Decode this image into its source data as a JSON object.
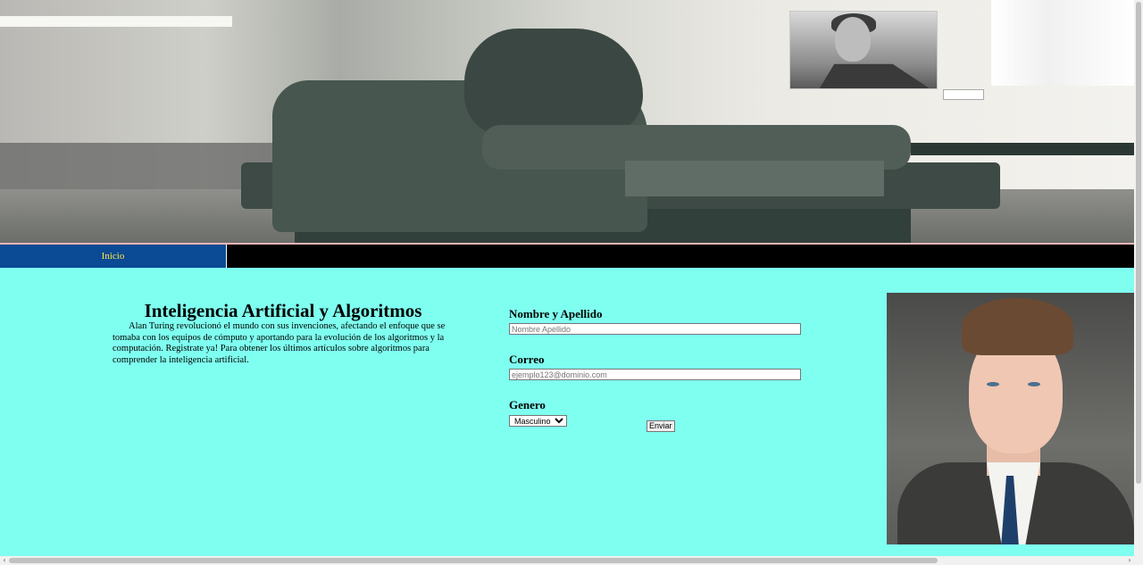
{
  "header": {
    "hero_image_alt": "",
    "nav": {
      "items": [
        {
          "label": "Inicio"
        }
      ]
    }
  },
  "intro": {
    "title": "Inteligencia Artificial y Algoritmos",
    "paragraph": "Alan Turing revolucionó el mundo con sus invenciones, afectando el enfoque que se tomaba con los equipos de cómputo y aportando para la evolución de los algoritmos y la computación. Registrate ya! Para obtener los últimos artículos sobre algoritmos para comprender la inteligencia artificial."
  },
  "form": {
    "name_label": "Nombre y Apellido",
    "name_placeholder": "Nombre Apellido",
    "email_label": "Correo",
    "email_placeholder": "ejemplo123@dominio.com",
    "gender_label": "Genero",
    "gender_selected": "Masculino",
    "submit_label": "Enviar"
  },
  "colors": {
    "page_bg": "#7ffff0",
    "nav_bg": "#000000",
    "nav_active_bg": "#0b4a94",
    "nav_active_text": "#ffe74a"
  },
  "icons": {
    "scroll_left": "chevron-left-icon",
    "scroll_right": "chevron-right-icon",
    "select_caret": "chevron-down-icon"
  }
}
